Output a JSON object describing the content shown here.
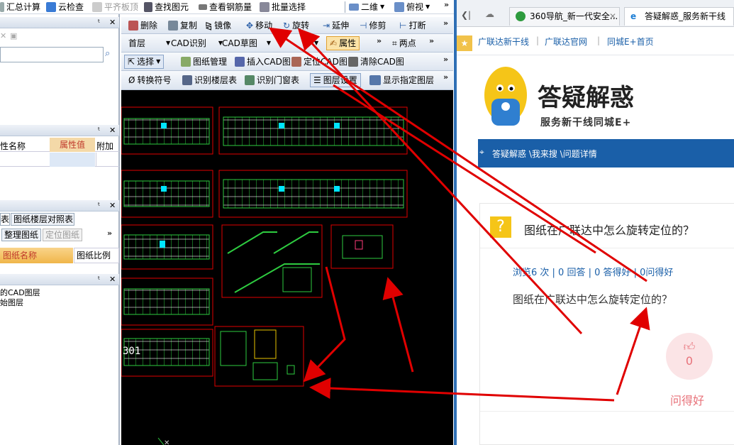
{
  "top_menu": {
    "items": [
      "汇总计算",
      "云检查",
      "平齐板顶",
      "查找图元",
      "查看钢筋量",
      "批量选择"
    ],
    "view_mode": "二维",
    "view_angle": "俯视"
  },
  "toolbar1": {
    "delete": "删除",
    "copy": "复制",
    "mirror": "镜像",
    "move": "移动",
    "rotate": "旋转",
    "extend": "延伸",
    "trim": "修剪",
    "break": "打断"
  },
  "toolbar2": {
    "floor": "首层",
    "cad_recognize": "CAD识别",
    "cad_draft": "CAD草图",
    "properties": "属性",
    "two_point": "两点"
  },
  "toolbar3": {
    "select": "选择",
    "drawing_manage": "图纸管理",
    "insert_cad": "插入CAD图",
    "locate_cad": "定位CAD图",
    "clear_cad": "清除CAD图"
  },
  "toolbar4": {
    "convert_symbol": "转换符号",
    "recognize_floor_table": "识别楼层表",
    "recognize_door_window": "识别门窗表",
    "layer_settings": "图层设置",
    "show_layer": "显示指定图层"
  },
  "left_panel": {
    "prop_name_header": "性名称",
    "prop_value_header": "属性值",
    "prop_extra_header": "附加",
    "tabs": [
      "表",
      "图纸楼层对照表"
    ],
    "organize_button": "整理图纸",
    "locate_button": "定位图纸",
    "drawing_name_header": "图纸名称",
    "drawing_scale_header": "图纸比例",
    "layer_items": [
      "的CAD图层",
      "始图层"
    ]
  },
  "cad_label": "301",
  "browser": {
    "tabs": [
      "360导航_新一代安全...",
      "答疑解惑_服务新干线"
    ],
    "bookmarks": [
      "广联达新干线",
      "广联达官网",
      "同城E+首页"
    ],
    "brand_title": "答疑解惑",
    "brand_subtitle": "服务新干线同城E+",
    "breadcrumb": "答疑解惑 \\我来搜 \\问题详情",
    "question_title": "图纸在广联达中怎么旋转定位的？",
    "stats": "浏览6 次 | 0 回答 | 0 答得好 | 0问得好",
    "question_body": "图纸在广联达中怎么旋转定位的？",
    "like_count": "0",
    "like_label": "问得好"
  },
  "colors": {
    "accent_blue": "#1a5fa8",
    "annotation_red": "#e00000",
    "like_pink": "#e8727a"
  }
}
